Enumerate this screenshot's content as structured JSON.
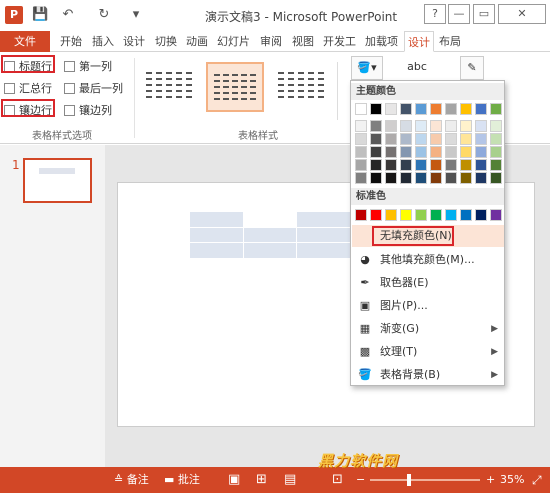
{
  "window": {
    "title": "演示文稿3 - Microsoft PowerPoint",
    "help": "?",
    "minimize": "—",
    "restore": "▭",
    "close": "✕"
  },
  "qat": {
    "save": "💾",
    "undo": "↶",
    "repeat": "↻"
  },
  "tabs": [
    "文件",
    "开始",
    "插入",
    "设计",
    "切换",
    "动画",
    "幻灯片",
    "审阅",
    "视图",
    "开发工",
    "加载项",
    "设计",
    "布局"
  ],
  "options": {
    "header_row": "标题行",
    "first_col": "第一列",
    "total_row": "汇总行",
    "last_col": "最后一列",
    "banded_rows": "镶边行",
    "banded_cols": "镶边列",
    "group_label": "表格样式选项"
  },
  "styles": {
    "group_label": "表格样式"
  },
  "tools": {
    "abc": "abc"
  },
  "slide": {
    "number": "1"
  },
  "dropdown": {
    "theme_colors_header": "主题颜色",
    "standard_colors_header": "标准色",
    "no_fill": "无填充颜色(N)",
    "more_colors": "其他填充颜色(M)...",
    "eyedropper": "取色器(E)",
    "picture": "图片(P)...",
    "gradient": "渐变(G)",
    "texture": "纹理(T)",
    "table_background": "表格背景(B)",
    "standard_colors": [
      "#c00000",
      "#ff0000",
      "#ffc000",
      "#ffff00",
      "#92d050",
      "#00b050",
      "#00b0f0",
      "#0070c0",
      "#002060",
      "#7030a0"
    ]
  },
  "status": {
    "notes": "备注",
    "comments": "批注",
    "zoom": "35%",
    "zoom_level": 0.35,
    "minus": "−",
    "plus": "+"
  },
  "watermark": "黑力软件网",
  "colors": {
    "accent": "#d24726",
    "highlight": "#fce4d6",
    "callout": "#d9262a"
  }
}
